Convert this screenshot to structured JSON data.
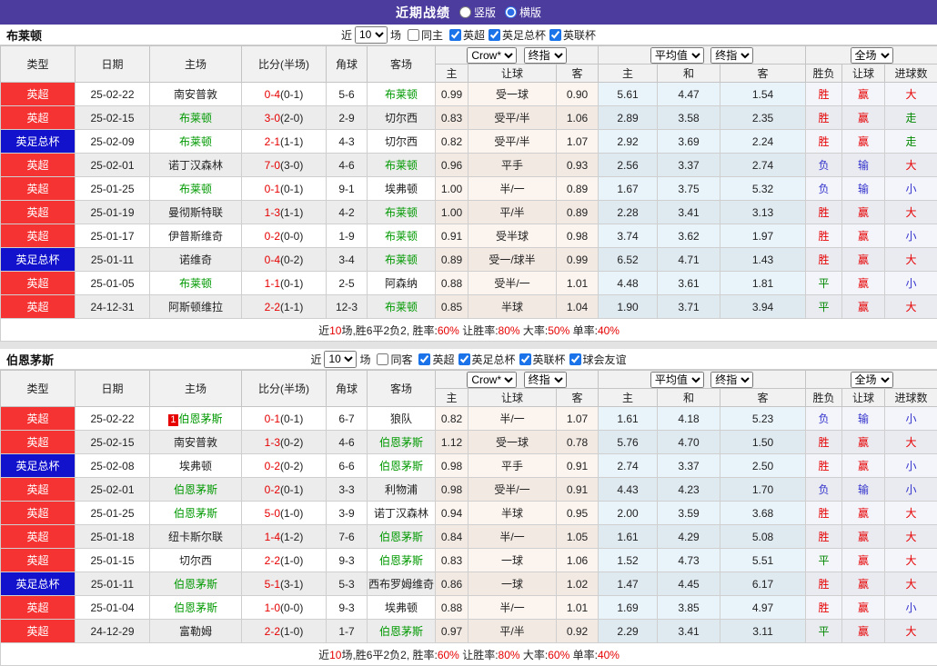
{
  "topbar": {
    "title": "近期战绩",
    "options": [
      {
        "label": "竖版",
        "selected": false
      },
      {
        "label": "横版",
        "selected": true
      }
    ]
  },
  "table_header": {
    "main": [
      "类型",
      "日期",
      "主场",
      "比分(半场)",
      "角球",
      "客场"
    ],
    "sub": [
      "主",
      "让球",
      "客",
      "主",
      "和",
      "客",
      "胜负",
      "让球",
      "进球数"
    ],
    "selects": {
      "company": "Crow*",
      "company_final": "终指",
      "europe": "平均值",
      "europe_final": "终指",
      "scope": "全场"
    }
  },
  "result_colors": {
    "胜": "red",
    "负": "blue",
    "平": "green",
    "赢": "red",
    "输": "blue",
    "大": "red",
    "小": "blue",
    "走": "green"
  },
  "sections": [
    {
      "team": "布莱顿",
      "filter": {
        "prefix": "近",
        "count": "10",
        "suffix": "场",
        "same": {
          "label": "同主",
          "checked": false
        },
        "leagues": [
          {
            "label": "英超",
            "checked": true
          },
          {
            "label": "英足总杯",
            "checked": true
          },
          {
            "label": "英联杯",
            "checked": true
          }
        ]
      },
      "rows": [
        {
          "league": "英超",
          "league_color": "red",
          "date": "25-02-22",
          "home": "南安普敦",
          "home_hl": false,
          "home_rank": "",
          "score": "0-4",
          "half": "(0-1)",
          "corner": "5-6",
          "away": "布莱顿",
          "away_hl": true,
          "asia_home": "0.99",
          "asia_line": "受一球",
          "asia_away": "0.90",
          "euro_home": "5.61",
          "euro_draw": "4.47",
          "euro_away": "1.54",
          "result": "胜",
          "asia_result": "赢",
          "goals_result": "大"
        },
        {
          "league": "英超",
          "league_color": "red",
          "date": "25-02-15",
          "home": "布莱顿",
          "home_hl": true,
          "home_rank": "",
          "score": "3-0",
          "half": "(2-0)",
          "corner": "2-9",
          "away": "切尔西",
          "away_hl": false,
          "asia_home": "0.83",
          "asia_line": "受平/半",
          "asia_away": "1.06",
          "euro_home": "2.89",
          "euro_draw": "3.58",
          "euro_away": "2.35",
          "result": "胜",
          "asia_result": "赢",
          "goals_result": "走"
        },
        {
          "league": "英足总杯",
          "league_color": "blue",
          "date": "25-02-09",
          "home": "布莱顿",
          "home_hl": true,
          "home_rank": "",
          "score": "2-1",
          "half": "(1-1)",
          "corner": "4-3",
          "away": "切尔西",
          "away_hl": false,
          "asia_home": "0.82",
          "asia_line": "受平/半",
          "asia_away": "1.07",
          "euro_home": "2.92",
          "euro_draw": "3.69",
          "euro_away": "2.24",
          "result": "胜",
          "asia_result": "赢",
          "goals_result": "走"
        },
        {
          "league": "英超",
          "league_color": "red",
          "date": "25-02-01",
          "home": "诺丁汉森林",
          "home_hl": false,
          "home_rank": "",
          "score": "7-0",
          "half": "(3-0)",
          "corner": "4-6",
          "away": "布莱顿",
          "away_hl": true,
          "asia_home": "0.96",
          "asia_line": "平手",
          "asia_away": "0.93",
          "euro_home": "2.56",
          "euro_draw": "3.37",
          "euro_away": "2.74",
          "result": "负",
          "asia_result": "输",
          "goals_result": "大"
        },
        {
          "league": "英超",
          "league_color": "red",
          "date": "25-01-25",
          "home": "布莱顿",
          "home_hl": true,
          "home_rank": "",
          "score": "0-1",
          "half": "(0-1)",
          "corner": "9-1",
          "away": "埃弗顿",
          "away_hl": false,
          "asia_home": "1.00",
          "asia_line": "半/一",
          "asia_away": "0.89",
          "euro_home": "1.67",
          "euro_draw": "3.75",
          "euro_away": "5.32",
          "result": "负",
          "asia_result": "输",
          "goals_result": "小"
        },
        {
          "league": "英超",
          "league_color": "red",
          "date": "25-01-19",
          "home": "曼彻斯特联",
          "home_hl": false,
          "home_rank": "",
          "score": "1-3",
          "half": "(1-1)",
          "corner": "4-2",
          "away": "布莱顿",
          "away_hl": true,
          "asia_home": "1.00",
          "asia_line": "平/半",
          "asia_away": "0.89",
          "euro_home": "2.28",
          "euro_draw": "3.41",
          "euro_away": "3.13",
          "result": "胜",
          "asia_result": "赢",
          "goals_result": "大"
        },
        {
          "league": "英超",
          "league_color": "red",
          "date": "25-01-17",
          "home": "伊普斯维奇",
          "home_hl": false,
          "home_rank": "",
          "score": "0-2",
          "half": "(0-0)",
          "corner": "1-9",
          "away": "布莱顿",
          "away_hl": true,
          "asia_home": "0.91",
          "asia_line": "受半球",
          "asia_away": "0.98",
          "euro_home": "3.74",
          "euro_draw": "3.62",
          "euro_away": "1.97",
          "result": "胜",
          "asia_result": "赢",
          "goals_result": "小"
        },
        {
          "league": "英足总杯",
          "league_color": "blue",
          "date": "25-01-11",
          "home": "诺维奇",
          "home_hl": false,
          "home_rank": "",
          "score": "0-4",
          "half": "(0-2)",
          "corner": "3-4",
          "away": "布莱顿",
          "away_hl": true,
          "asia_home": "0.89",
          "asia_line": "受一/球半",
          "asia_away": "0.99",
          "euro_home": "6.52",
          "euro_draw": "4.71",
          "euro_away": "1.43",
          "result": "胜",
          "asia_result": "赢",
          "goals_result": "大"
        },
        {
          "league": "英超",
          "league_color": "red",
          "date": "25-01-05",
          "home": "布莱顿",
          "home_hl": true,
          "home_rank": "",
          "score": "1-1",
          "half": "(0-1)",
          "corner": "2-5",
          "away": "阿森纳",
          "away_hl": false,
          "asia_home": "0.88",
          "asia_line": "受半/一",
          "asia_away": "1.01",
          "euro_home": "4.48",
          "euro_draw": "3.61",
          "euro_away": "1.81",
          "result": "平",
          "asia_result": "赢",
          "goals_result": "小"
        },
        {
          "league": "英超",
          "league_color": "red",
          "date": "24-12-31",
          "home": "阿斯顿维拉",
          "home_hl": false,
          "home_rank": "",
          "score": "2-2",
          "half": "(1-1)",
          "corner": "12-3",
          "away": "布莱顿",
          "away_hl": true,
          "asia_home": "0.85",
          "asia_line": "半球",
          "asia_away": "1.04",
          "euro_home": "1.90",
          "euro_draw": "3.71",
          "euro_away": "3.94",
          "result": "平",
          "asia_result": "赢",
          "goals_result": "大"
        }
      ],
      "summary": [
        {
          "t": "近"
        },
        {
          "t": "10",
          "red": true
        },
        {
          "t": "场,胜6平2负2, 胜率:"
        },
        {
          "t": "60%",
          "red": true
        },
        {
          "t": " 让胜率:"
        },
        {
          "t": "80%",
          "red": true
        },
        {
          "t": " 大率:"
        },
        {
          "t": "50%",
          "red": true
        },
        {
          "t": " 单率:"
        },
        {
          "t": "40%",
          "red": true
        }
      ]
    },
    {
      "team": "伯恩茅斯",
      "filter": {
        "prefix": "近",
        "count": "10",
        "suffix": "场",
        "same": {
          "label": "同客",
          "checked": false
        },
        "leagues": [
          {
            "label": "英超",
            "checked": true
          },
          {
            "label": "英足总杯",
            "checked": true
          },
          {
            "label": "英联杯",
            "checked": true
          },
          {
            "label": "球会友谊",
            "checked": true
          }
        ]
      },
      "rows": [
        {
          "league": "英超",
          "league_color": "red",
          "date": "25-02-22",
          "home": "伯恩茅斯",
          "home_hl": true,
          "home_rank": "1",
          "score": "0-1",
          "half": "(0-1)",
          "corner": "6-7",
          "away": "狼队",
          "away_hl": false,
          "asia_home": "0.82",
          "asia_line": "半/一",
          "asia_away": "1.07",
          "euro_home": "1.61",
          "euro_draw": "4.18",
          "euro_away": "5.23",
          "result": "负",
          "asia_result": "输",
          "goals_result": "小"
        },
        {
          "league": "英超",
          "league_color": "red",
          "date": "25-02-15",
          "home": "南安普敦",
          "home_hl": false,
          "home_rank": "",
          "score": "1-3",
          "half": "(0-2)",
          "corner": "4-6",
          "away": "伯恩茅斯",
          "away_hl": true,
          "asia_home": "1.12",
          "asia_line": "受一球",
          "asia_away": "0.78",
          "euro_home": "5.76",
          "euro_draw": "4.70",
          "euro_away": "1.50",
          "result": "胜",
          "asia_result": "赢",
          "goals_result": "大"
        },
        {
          "league": "英足总杯",
          "league_color": "blue",
          "date": "25-02-08",
          "home": "埃弗顿",
          "home_hl": false,
          "home_rank": "",
          "score": "0-2",
          "half": "(0-2)",
          "corner": "6-6",
          "away": "伯恩茅斯",
          "away_hl": true,
          "asia_home": "0.98",
          "asia_line": "平手",
          "asia_away": "0.91",
          "euro_home": "2.74",
          "euro_draw": "3.37",
          "euro_away": "2.50",
          "result": "胜",
          "asia_result": "赢",
          "goals_result": "小"
        },
        {
          "league": "英超",
          "league_color": "red",
          "date": "25-02-01",
          "home": "伯恩茅斯",
          "home_hl": true,
          "home_rank": "",
          "score": "0-2",
          "half": "(0-1)",
          "corner": "3-3",
          "away": "利物浦",
          "away_hl": false,
          "asia_home": "0.98",
          "asia_line": "受半/一",
          "asia_away": "0.91",
          "euro_home": "4.43",
          "euro_draw": "4.23",
          "euro_away": "1.70",
          "result": "负",
          "asia_result": "输",
          "goals_result": "小"
        },
        {
          "league": "英超",
          "league_color": "red",
          "date": "25-01-25",
          "home": "伯恩茅斯",
          "home_hl": true,
          "home_rank": "",
          "score": "5-0",
          "half": "(1-0)",
          "corner": "3-9",
          "away": "诺丁汉森林",
          "away_hl": false,
          "asia_home": "0.94",
          "asia_line": "半球",
          "asia_away": "0.95",
          "euro_home": "2.00",
          "euro_draw": "3.59",
          "euro_away": "3.68",
          "result": "胜",
          "asia_result": "赢",
          "goals_result": "大"
        },
        {
          "league": "英超",
          "league_color": "red",
          "date": "25-01-18",
          "home": "纽卡斯尔联",
          "home_hl": false,
          "home_rank": "",
          "score": "1-4",
          "half": "(1-2)",
          "corner": "7-6",
          "away": "伯恩茅斯",
          "away_hl": true,
          "asia_home": "0.84",
          "asia_line": "半/一",
          "asia_away": "1.05",
          "euro_home": "1.61",
          "euro_draw": "4.29",
          "euro_away": "5.08",
          "result": "胜",
          "asia_result": "赢",
          "goals_result": "大"
        },
        {
          "league": "英超",
          "league_color": "red",
          "date": "25-01-15",
          "home": "切尔西",
          "home_hl": false,
          "home_rank": "",
          "score": "2-2",
          "half": "(1-0)",
          "corner": "9-3",
          "away": "伯恩茅斯",
          "away_hl": true,
          "asia_home": "0.83",
          "asia_line": "一球",
          "asia_away": "1.06",
          "euro_home": "1.52",
          "euro_draw": "4.73",
          "euro_away": "5.51",
          "result": "平",
          "asia_result": "赢",
          "goals_result": "大"
        },
        {
          "league": "英足总杯",
          "league_color": "blue",
          "date": "25-01-11",
          "home": "伯恩茅斯",
          "home_hl": true,
          "home_rank": "",
          "score": "5-1",
          "half": "(3-1)",
          "corner": "5-3",
          "away": "西布罗姆维奇",
          "away_hl": false,
          "asia_home": "0.86",
          "asia_line": "一球",
          "asia_away": "1.02",
          "euro_home": "1.47",
          "euro_draw": "4.45",
          "euro_away": "6.17",
          "result": "胜",
          "asia_result": "赢",
          "goals_result": "大"
        },
        {
          "league": "英超",
          "league_color": "red",
          "date": "25-01-04",
          "home": "伯恩茅斯",
          "home_hl": true,
          "home_rank": "",
          "score": "1-0",
          "half": "(0-0)",
          "corner": "9-3",
          "away": "埃弗顿",
          "away_hl": false,
          "asia_home": "0.88",
          "asia_line": "半/一",
          "asia_away": "1.01",
          "euro_home": "1.69",
          "euro_draw": "3.85",
          "euro_away": "4.97",
          "result": "胜",
          "asia_result": "赢",
          "goals_result": "小"
        },
        {
          "league": "英超",
          "league_color": "red",
          "date": "24-12-29",
          "home": "富勒姆",
          "home_hl": false,
          "home_rank": "",
          "score": "2-2",
          "half": "(1-0)",
          "corner": "1-7",
          "away": "伯恩茅斯",
          "away_hl": true,
          "asia_home": "0.97",
          "asia_line": "平/半",
          "asia_away": "0.92",
          "euro_home": "2.29",
          "euro_draw": "3.41",
          "euro_away": "3.11",
          "result": "平",
          "asia_result": "赢",
          "goals_result": "大"
        }
      ],
      "summary": [
        {
          "t": "近"
        },
        {
          "t": "10",
          "red": true
        },
        {
          "t": "场,胜6平2负2, 胜率:"
        },
        {
          "t": "60%",
          "red": true
        },
        {
          "t": " 让胜率:"
        },
        {
          "t": "80%",
          "red": true
        },
        {
          "t": " 大率:"
        },
        {
          "t": "60%",
          "red": true
        },
        {
          "t": " 单率:"
        },
        {
          "t": "40%",
          "red": true
        }
      ]
    }
  ]
}
